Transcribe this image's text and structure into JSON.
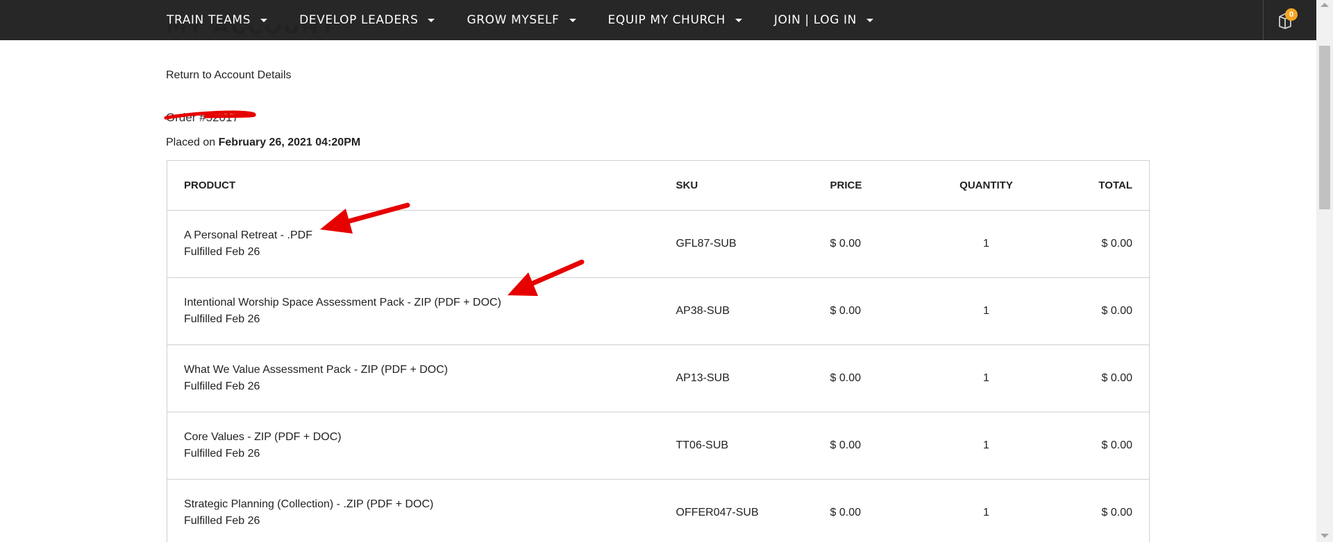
{
  "nav": {
    "items": [
      {
        "label": "TRAIN TEAMS"
      },
      {
        "label": "DEVELOP LEADERS"
      },
      {
        "label": "GROW MYSELF"
      },
      {
        "label": "EQUIP MY CHURCH"
      },
      {
        "label": "JOIN | LOG IN"
      }
    ],
    "cart_count": "0"
  },
  "page": {
    "heading": "MY ACCOUNT",
    "return_link": "Return to Account Details",
    "order_number": "Order #52017",
    "placed_on_prefix": "Placed on",
    "placed_on_date": "February 26, 2021 04:20PM"
  },
  "table": {
    "headers": {
      "product": "PRODUCT",
      "sku": "SKU",
      "price": "PRICE",
      "quantity": "QUANTITY",
      "total": "TOTAL"
    },
    "rows": [
      {
        "product": "A Personal Retreat - .PDF",
        "status": "Fulfilled Feb 26",
        "sku": "GFL87-SUB",
        "price": "$ 0.00",
        "quantity": "1",
        "total": "$ 0.00"
      },
      {
        "product": "Intentional Worship Space Assessment Pack - ZIP (PDF + DOC)",
        "status": "Fulfilled Feb 26",
        "sku": "AP38-SUB",
        "price": "$ 0.00",
        "quantity": "1",
        "total": "$ 0.00"
      },
      {
        "product": "What We Value Assessment Pack - ZIP (PDF + DOC)",
        "status": "Fulfilled Feb 26",
        "sku": "AP13-SUB",
        "price": "$ 0.00",
        "quantity": "1",
        "total": "$ 0.00"
      },
      {
        "product": "Core Values - ZIP (PDF + DOC)",
        "status": "Fulfilled Feb 26",
        "sku": "TT06-SUB",
        "price": "$ 0.00",
        "quantity": "1",
        "total": "$ 0.00"
      },
      {
        "product": "Strategic Planning (Collection) - .ZIP (PDF + DOC)",
        "status": "Fulfilled Feb 26",
        "sku": "OFFER047-SUB",
        "price": "$ 0.00",
        "quantity": "1",
        "total": "$ 0.00"
      }
    ]
  },
  "colors": {
    "nav_background": "#272727",
    "annotation_red": "#e60000",
    "cart_badge": "#f5a623"
  }
}
